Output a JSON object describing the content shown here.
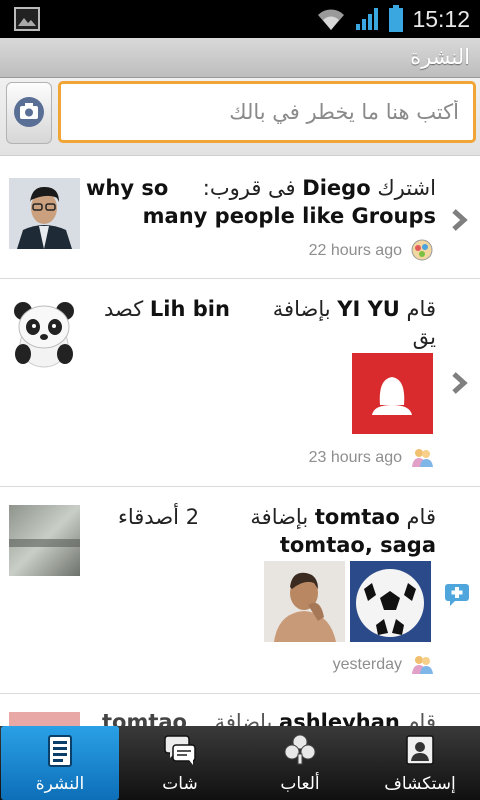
{
  "status_bar": {
    "time": "15:12",
    "icons": [
      "gallery-icon",
      "wifi-icon",
      "signal-icon",
      "battery-icon"
    ]
  },
  "header": {
    "title": "النشرة"
  },
  "composer": {
    "placeholder": "أكتب هنا ما يخطر في بالك",
    "camera_icon": "camera-icon"
  },
  "feed": [
    {
      "line1": {
        "prefix": "اشترك",
        "name": "Diego",
        "mid": "فى قروب:",
        "tail": "why so"
      },
      "line2": "many people like Groups",
      "time": "22 hours ago",
      "icon": "groups-icon"
    },
    {
      "line1": {
        "prefix": "قام",
        "name": "YI YU",
        "mid": "بإضافة",
        "tail": "Lih bin",
        "after": "كصد"
      },
      "line2": "يق",
      "time": "23 hours ago",
      "icon": "friends-icon"
    },
    {
      "line1": {
        "prefix": "قام",
        "name": "tomtao",
        "mid": "بإضافة",
        "count": "2 أصدقاء"
      },
      "line2": "tomtao, saga",
      "time": "yesterday",
      "icon": "friends-icon"
    },
    {
      "line1": {
        "prefix": "قام",
        "name": "ashleyhan",
        "mid": "بإضافة",
        "tail": "tomtao"
      }
    }
  ],
  "tabs": [
    {
      "label": "النشرة",
      "icon": "news-icon",
      "active": true
    },
    {
      "label": "شات",
      "icon": "chat-icon",
      "active": false
    },
    {
      "label": "ألعاب",
      "icon": "games-icon",
      "active": false
    },
    {
      "label": "إستكشاف",
      "icon": "explore-icon",
      "active": false
    }
  ],
  "colors": {
    "accent_input_border": "#f2a537",
    "active_tab": "#1a8ad4"
  }
}
